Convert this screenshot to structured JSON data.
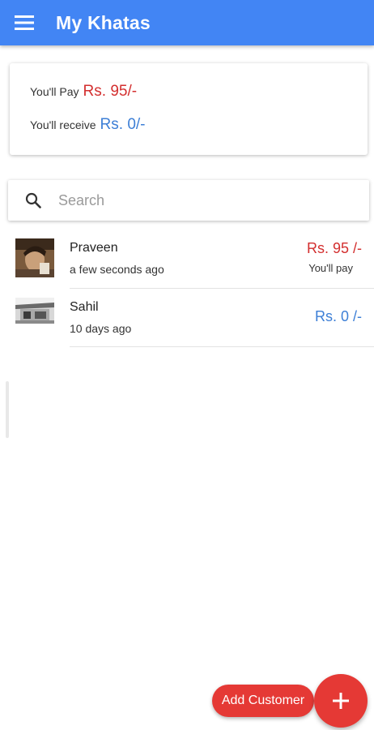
{
  "appbar": {
    "title": "My Khatas",
    "menu_icon": "menu-icon",
    "color": "#4285f4"
  },
  "summary": {
    "pay_label": "You'll Pay",
    "pay_value": "Rs. 95/-",
    "receive_label": "You'll receive",
    "receive_value": "Rs. 0/-",
    "pay_color": "#d32f2f",
    "receive_color": "#3d7fd6"
  },
  "search": {
    "icon": "search-icon",
    "placeholder": "Search",
    "value": ""
  },
  "customers": [
    {
      "name": "Praveen",
      "time": "a few seconds ago",
      "amount": "Rs. 95 /-",
      "status": "You'll pay",
      "amount_color": "#d32f2f"
    },
    {
      "name": "Sahil",
      "time": "10 days ago",
      "amount": "Rs. 0 /-",
      "status": "",
      "amount_color": "#3d7fd6"
    }
  ],
  "actions": {
    "add_customer_label": "Add Customer",
    "fab_icon": "plus-icon",
    "fab_color": "#e53935"
  }
}
